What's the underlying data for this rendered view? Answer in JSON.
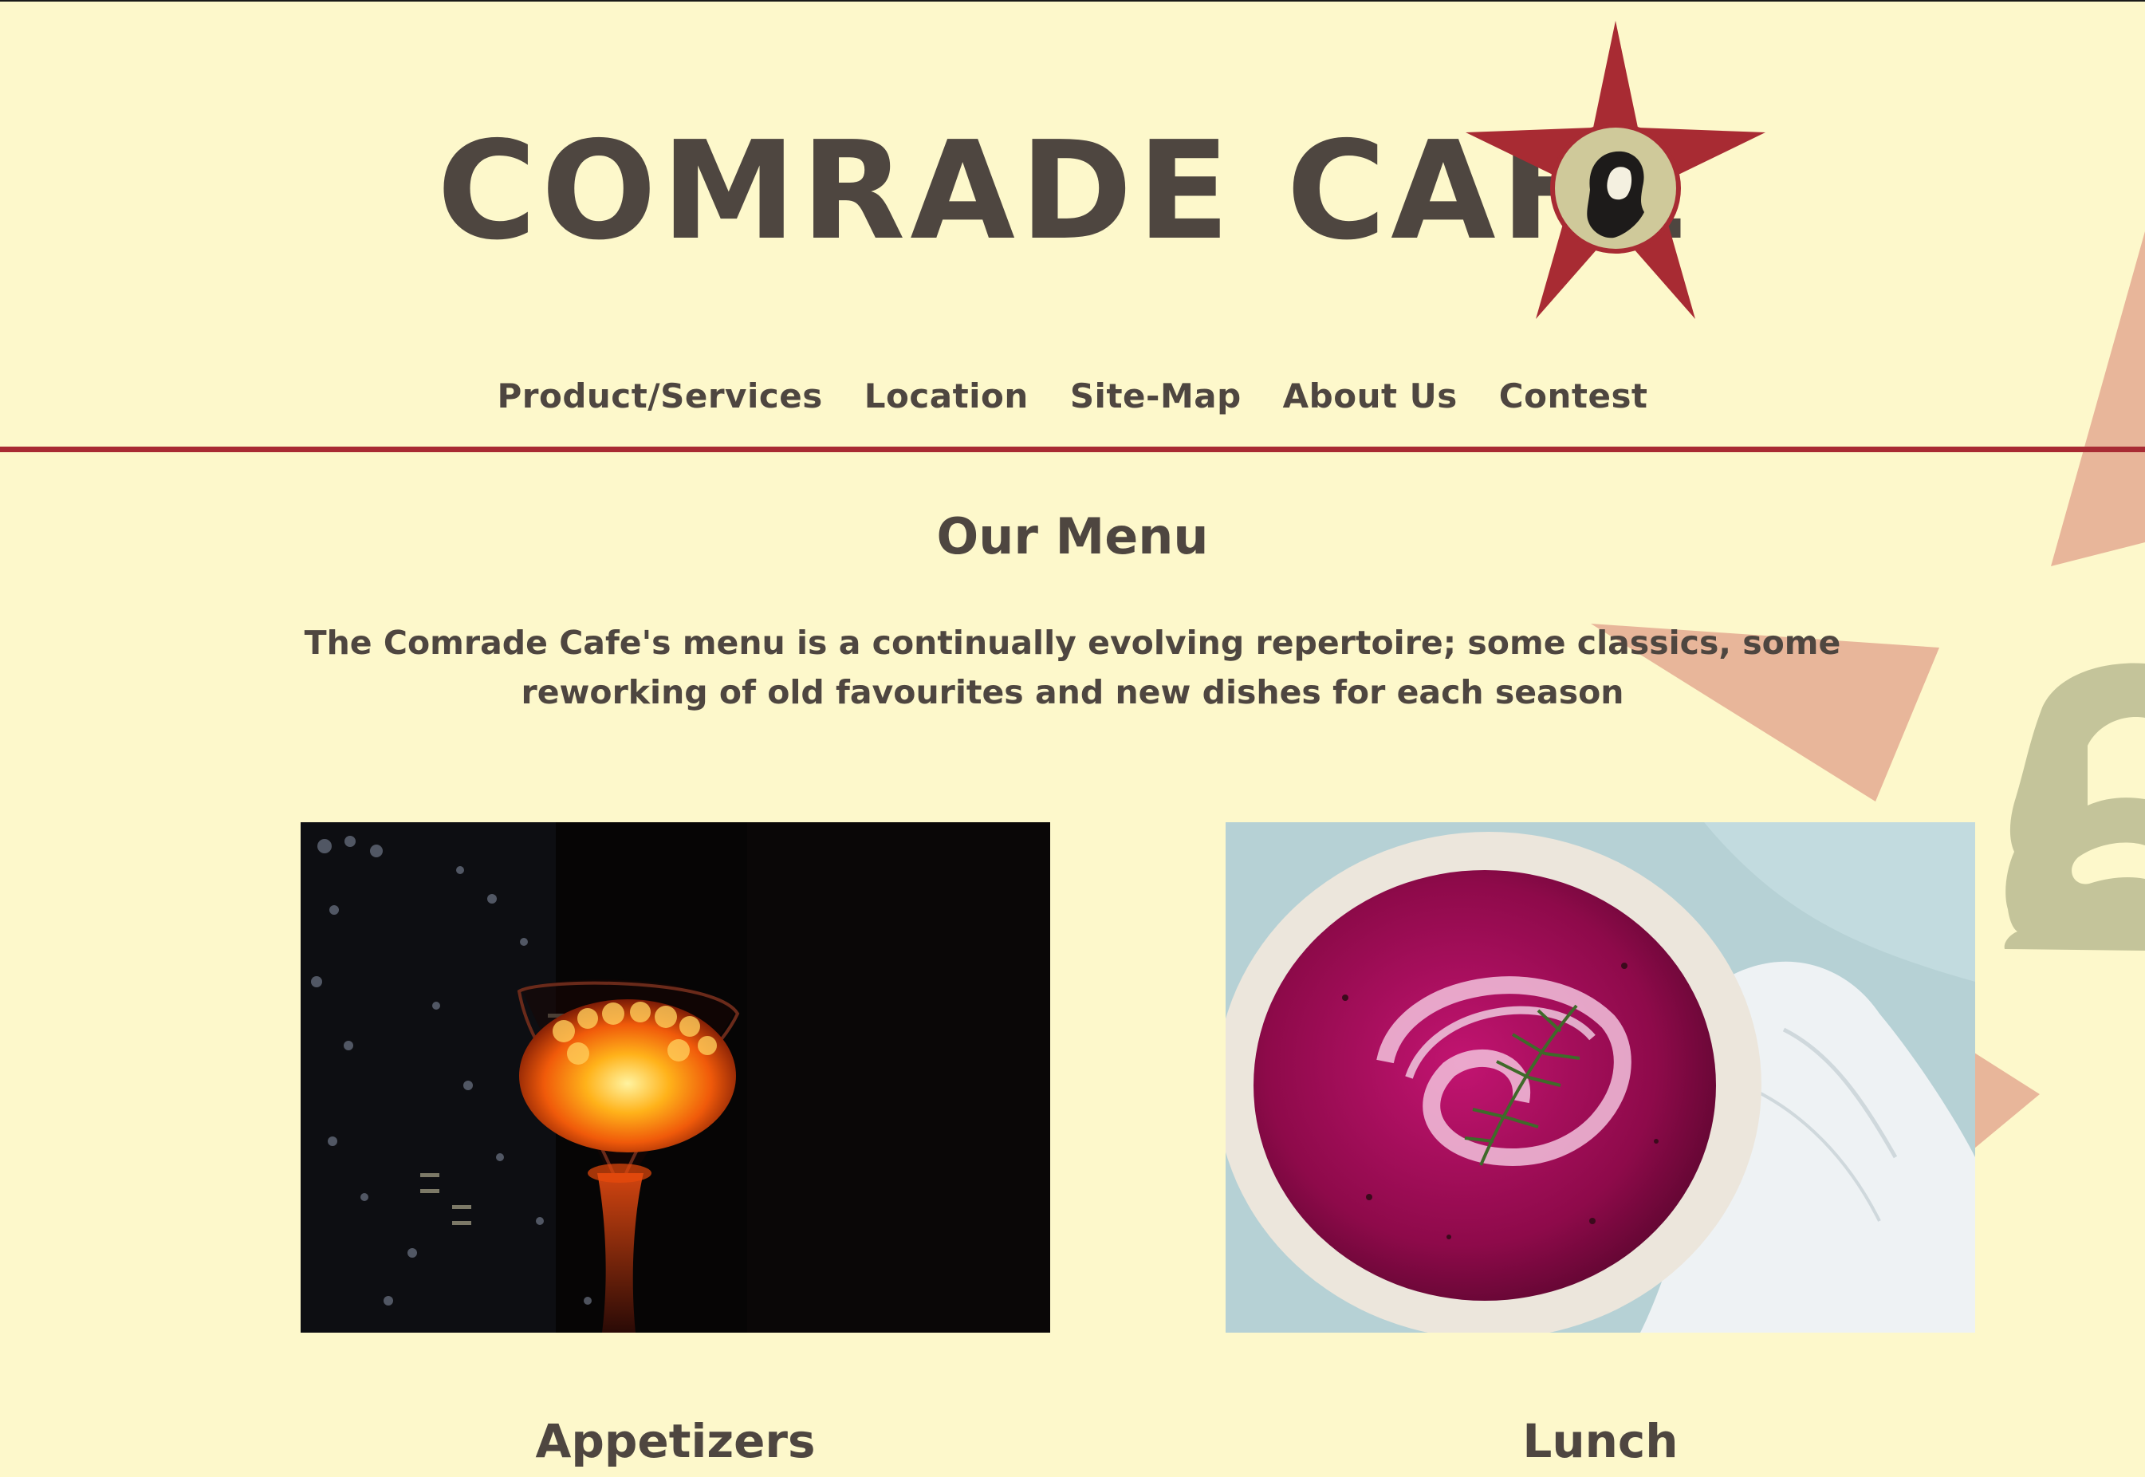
{
  "header": {
    "title": "COMRADE CAFE",
    "logo_icon": "red-star-portrait-icon"
  },
  "nav": {
    "items": [
      {
        "label": "Product/Services"
      },
      {
        "label": "Location"
      },
      {
        "label": "Site-Map"
      },
      {
        "label": "About Us"
      },
      {
        "label": "Contest"
      }
    ]
  },
  "main": {
    "heading": "Our Menu",
    "intro": "The Comrade Cafe's menu is a continually evolving repertoire; some classics, some reworking of old favourites and new dishes for each season",
    "cards": [
      {
        "title": "Appetizers",
        "image": "glowing-caviar-cocktail-glass-photo"
      },
      {
        "title": "Lunch",
        "image": "beet-soup-bowl-photo"
      }
    ]
  },
  "colors": {
    "background": "#fdf8cb",
    "text": "#4e4640",
    "accent_red": "#a82b33",
    "deco_salmon": "#e8b69a",
    "deco_sage": "#c4c49a"
  }
}
